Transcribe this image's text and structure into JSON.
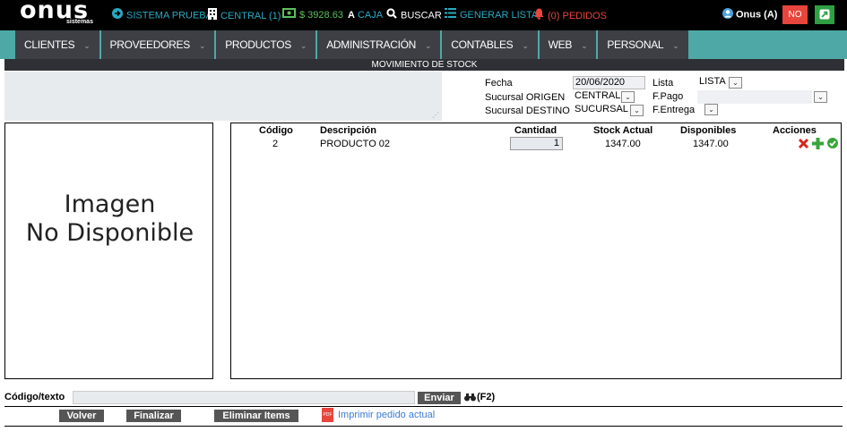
{
  "brand": {
    "name": "onus",
    "sub": "sistemas"
  },
  "topbar": {
    "system": "SISTEMA PRUEBA",
    "branch": "CENTRAL (1)",
    "cash": "$ 3928.63",
    "box": "CAJA",
    "search": "BUSCAR",
    "generate": "GENERAR LISTA",
    "orders": "(0) PEDIDOS",
    "user": "Onus (A)",
    "no_button": "NO"
  },
  "menu": [
    "CLIENTES",
    "PROVEEDORES",
    "PRODUCTOS",
    "ADMINISTRACIÓN",
    "CONTABLES",
    "WEB",
    "PERSONAL"
  ],
  "page_title": "MOVIMIENTO DE STOCK",
  "form": {
    "fecha_label": "Fecha",
    "fecha_value": "20/06/2020",
    "lista_label": "Lista",
    "lista_value": "LISTA",
    "origen_label": "Sucursal ORIGEN",
    "origen_value": "CENTRAL",
    "fpago_label": "F.Pago",
    "destino_label": "Sucursal DESTINO",
    "destino_value": "SUCURSAL",
    "fentrega_label": "F.Entrega"
  },
  "image_panel": {
    "line1": "Imagen",
    "line2": "No Disponible"
  },
  "table": {
    "headers": {
      "codigo": "Código",
      "descripcion": "Descripción",
      "cantidad": "Cantidad",
      "stock": "Stock Actual",
      "disponibles": "Disponibles",
      "acciones": "Acciones"
    },
    "rows": [
      {
        "codigo": "2",
        "descripcion": "PRODUCTO 02",
        "cantidad": "1",
        "stock": "1347.00",
        "disponibles": "1347.00"
      }
    ]
  },
  "bottom": {
    "code_label": "Código/texto",
    "send": "Enviar",
    "shortcut": "(F2)",
    "back": "Volver",
    "finish": "Finalizar",
    "delete": "Eliminar Items",
    "print": "Imprimir pedido actual",
    "pdf": "PDF"
  },
  "colors": {
    "teal_menu": "#4ea9a6",
    "topbar": "#000000",
    "accent_red": "#e8453c",
    "accent_green": "#2ea043"
  }
}
